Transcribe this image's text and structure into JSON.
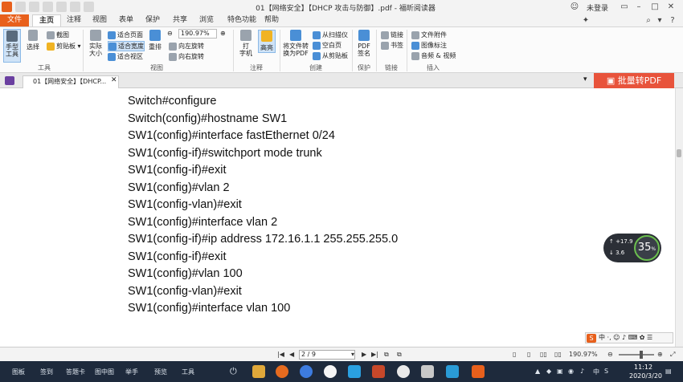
{
  "window": {
    "title": "01【网络安全】【DHCP 攻击与防御】.pdf - 福昕阅读器",
    "login": "未登录",
    "search_placeholder": "查找"
  },
  "tabs": [
    {
      "label": "文件"
    },
    {
      "label": "主页"
    },
    {
      "label": "注释"
    },
    {
      "label": "视图"
    },
    {
      "label": "表单"
    },
    {
      "label": "保护"
    },
    {
      "label": "共享"
    },
    {
      "label": "浏览"
    },
    {
      "label": "特色功能"
    },
    {
      "label": "帮助"
    }
  ],
  "ribbon": {
    "hand_tool": "手型\n工具",
    "select": "选择",
    "screenshot": "截图",
    "clipboard": "剪贴板",
    "tools_group": "工具",
    "actual_size": "实际\n大小",
    "fit_page": "适合页面",
    "fit_width": "适合宽度",
    "fit_visible": "适合视区",
    "reflow": "重排",
    "zoom_value": "190.97%",
    "rotate_left": "向左旋转",
    "rotate_right": "向右旋转",
    "view_group": "视图",
    "typewriter": "打\n字机",
    "highlight": "高亮",
    "comment_group": "注释",
    "to_pdf": "将文件转\n换为PDF",
    "from_scanner": "从扫描仪",
    "blank_page": "空白页",
    "from_clipboard": "从剪贴板",
    "create_group": "创建",
    "pdf_sign": "PDF\n签名",
    "protect_group": "保护",
    "link": "链接",
    "bookmark": "书签",
    "links_group": "链接",
    "file_attachment": "文件附件",
    "image_annotation": "图像标注",
    "audio_video": "音频 & 视频",
    "insert_group": "插入"
  },
  "doc_tab": {
    "label": "01【网络安全】【DHCP..."
  },
  "batch_pdf_button": "批量转PDF",
  "document_lines": [
    "Switch#configure",
    "Switch(config)#hostname SW1",
    "SW1(config)#interface fastEthernet 0/24",
    "SW1(config-if)#switchport mode trunk",
    "SW1(config-if)#exit",
    "SW1(config)#vlan 2",
    "SW1(config-vlan)#exit",
    "SW1(config)#interface vlan 2",
    "SW1(config-if)#ip address 172.16.1.1 255.255.255.0",
    "SW1(config-if)#exit",
    "SW1(config)#vlan 100",
    "SW1(config-vlan)#exit",
    "SW1(config)#interface vlan 100"
  ],
  "speed_widget": {
    "up": "+17.9",
    "down": "3.6",
    "percent": "35"
  },
  "statusbar": {
    "page": "2 / 9",
    "zoom": "190.97%"
  },
  "ime": {
    "label": "中 ·, ☺ ♪ ⌨ ✿ ☰"
  },
  "taskbar": {
    "items": [
      "图板",
      "签到",
      "答题卡",
      "图中图",
      "举手",
      "预览",
      "工具"
    ],
    "time": "11:12",
    "date": "2020/3/20",
    "lang": "中"
  },
  "colors": {
    "accent": "#e8601c",
    "batch_button": "#e8533b",
    "taskbar": "#1e2a3c"
  }
}
